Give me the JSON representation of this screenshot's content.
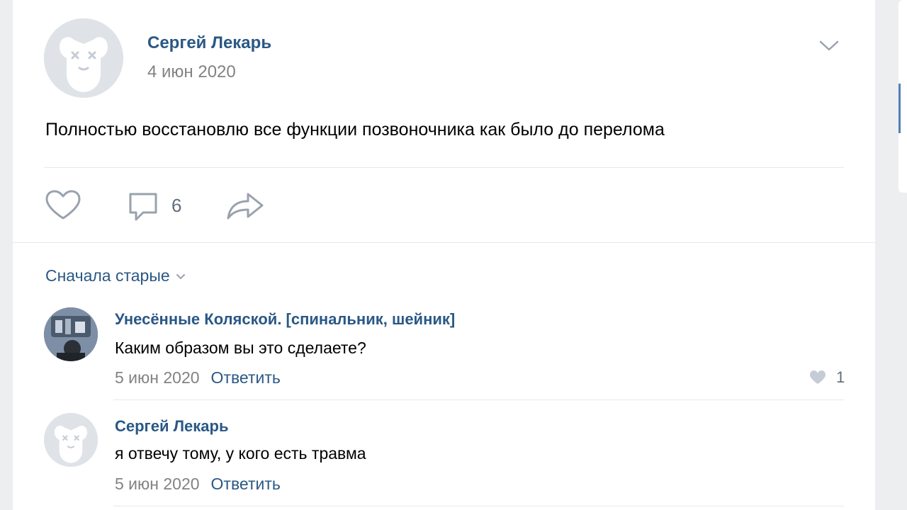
{
  "post": {
    "author": "Сергей Лекарь",
    "date": "4 июн 2020",
    "text": "Полностью восстановлю все функции позвоночника как было до перелома",
    "comments_count": "6"
  },
  "comments_section": {
    "sort_label": "Сначала старые"
  },
  "comments": [
    {
      "author": "Унесённые Коляской. [спинальник, шейник]",
      "text": "Каким образом вы это сделаете?",
      "date": "5 июн 2020",
      "reply_label": "Ответить",
      "likes": "1"
    },
    {
      "author": "Сергей Лекарь",
      "text": "я отвечу тому, у кого есть травма",
      "date": "5 июн 2020",
      "reply_label": "Ответить"
    }
  ],
  "colors": {
    "link": "#2a5885",
    "meta": "#828282",
    "icon": "#99a2ad",
    "accent": "#5181b8"
  },
  "icons": [
    "default-avatar-icon",
    "chevron-down-icon",
    "heart-icon",
    "comment-icon",
    "share-icon"
  ]
}
